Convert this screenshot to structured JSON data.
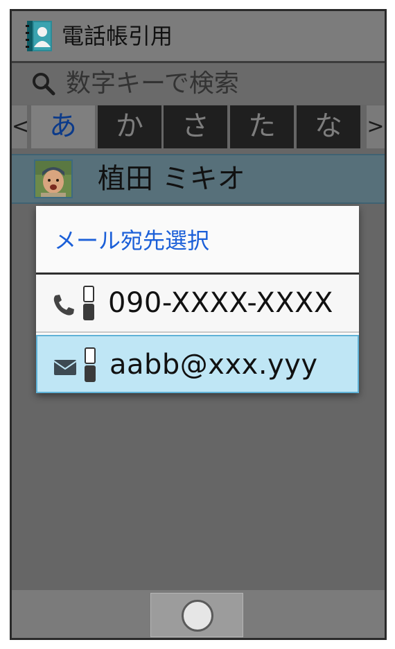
{
  "header": {
    "title": "電話帳引用",
    "icon": "contacts-book-icon"
  },
  "search": {
    "placeholder": "数字キーで検索",
    "icon": "search-icon"
  },
  "tabs": {
    "prev_arrow": "<",
    "next_arrow": ">",
    "items": [
      {
        "label": "あ",
        "active": true
      },
      {
        "label": "か",
        "active": false
      },
      {
        "label": "さ",
        "active": false
      },
      {
        "label": "た",
        "active": false
      },
      {
        "label": "な",
        "active": false
      }
    ]
  },
  "contact": {
    "name": "植田 ミキオ",
    "avatar": "child-photo"
  },
  "dialog": {
    "title": "メール宛先選択",
    "options": [
      {
        "type_icon": "phone-icon",
        "device_icon": "mobile-phone-icon",
        "value": "090-XXXX-XXXX",
        "selected": false
      },
      {
        "type_icon": "mail-icon",
        "device_icon": "mobile-phone-icon",
        "value": "aabb@xxx.yyy",
        "selected": true
      }
    ]
  },
  "colors": {
    "dialog_title": "#1b5fd8",
    "selected_option_bg": "#bfe6f5",
    "active_tab_text": "#0b3a8a"
  }
}
